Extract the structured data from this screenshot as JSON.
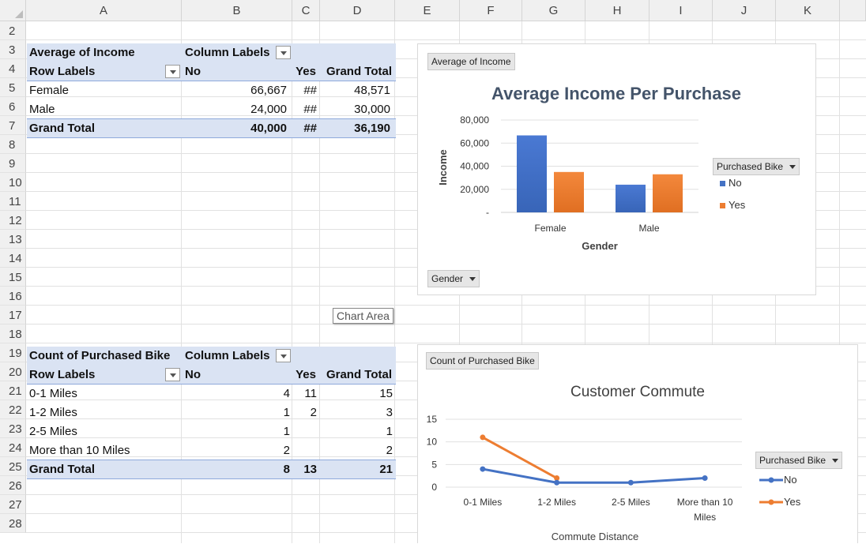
{
  "columns": [
    "A",
    "B",
    "C",
    "D",
    "E",
    "F",
    "G",
    "H",
    "I",
    "J",
    "K"
  ],
  "rows": [
    "2",
    "3",
    "4",
    "5",
    "6",
    "7",
    "8",
    "9",
    "10",
    "11",
    "12",
    "13",
    "14",
    "15",
    "16",
    "17",
    "18",
    "19",
    "20",
    "21",
    "22",
    "23",
    "24",
    "25",
    "26",
    "27",
    "28"
  ],
  "pivot1": {
    "title": "Average of Income",
    "col_labels": "Column Labels",
    "row_labels": "Row Labels",
    "hdr_no": "No",
    "hdr_yes": "Yes",
    "hdr_total": "Grand Total",
    "rows": [
      {
        "label": "Female",
        "no": "66,667",
        "yes": "##",
        "total": "48,571"
      },
      {
        "label": "Male",
        "no": "24,000",
        "yes": "##",
        "total": "30,000"
      }
    ],
    "grand": {
      "label": "Grand Total",
      "no": "40,000",
      "yes": "##",
      "total": "36,190"
    }
  },
  "pivot2": {
    "title": "Count of Purchased Bike",
    "col_labels": "Column Labels",
    "row_labels": "Row Labels",
    "hdr_no": "No",
    "hdr_yes": "Yes",
    "hdr_total": "Grand Total",
    "rows": [
      {
        "label": "0-1 Miles",
        "no": "4",
        "yes": "11",
        "total": "15"
      },
      {
        "label": "1-2 Miles",
        "no": "1",
        "yes": "2",
        "total": "3"
      },
      {
        "label": "2-5 Miles",
        "no": "1",
        "yes": "",
        "total": "1"
      },
      {
        "label": "More than 10 Miles",
        "no": "2",
        "yes": "",
        "total": "2"
      }
    ],
    "grand": {
      "label": "Grand Total",
      "no": "8",
      "yes": "13",
      "total": "21"
    }
  },
  "tooltip": "Chart Area",
  "chart1": {
    "field_button": "Average of Income",
    "axis_button": "Gender",
    "legend_button": "Purchased Bike"
  },
  "chart2": {
    "field_button": "Count of Purchased Bike",
    "legend_button": "Purchased Bike"
  },
  "colors": {
    "no": "#4472c4",
    "yes": "#ed7d31",
    "pivot_band": "#dae3f3"
  },
  "chart_data": [
    {
      "type": "bar",
      "title": "Average Income Per Purchase",
      "xlabel": "Gender",
      "ylabel": "Income",
      "categories": [
        "Female",
        "Male"
      ],
      "series": [
        {
          "name": "No",
          "values": [
            66667,
            24000
          ]
        },
        {
          "name": "Yes",
          "values": [
            35000,
            33000
          ]
        }
      ],
      "ylim": [
        0,
        80000
      ],
      "yticks": [
        "-",
        "20,000",
        "40,000",
        "60,000",
        "80,000"
      ],
      "legend": "right"
    },
    {
      "type": "line",
      "title": "Customer Commute",
      "xlabel": "Commute Distance",
      "ylabel": "",
      "categories": [
        "0-1 Miles",
        "1-2 Miles",
        "2-5 Miles",
        "More than 10 Miles"
      ],
      "series": [
        {
          "name": "No",
          "values": [
            4,
            1,
            1,
            2
          ]
        },
        {
          "name": "Yes",
          "values": [
            11,
            2,
            null,
            null
          ]
        }
      ],
      "ylim": [
        0,
        15
      ],
      "yticks": [
        "0",
        "5",
        "10",
        "15"
      ],
      "legend": "right"
    }
  ]
}
